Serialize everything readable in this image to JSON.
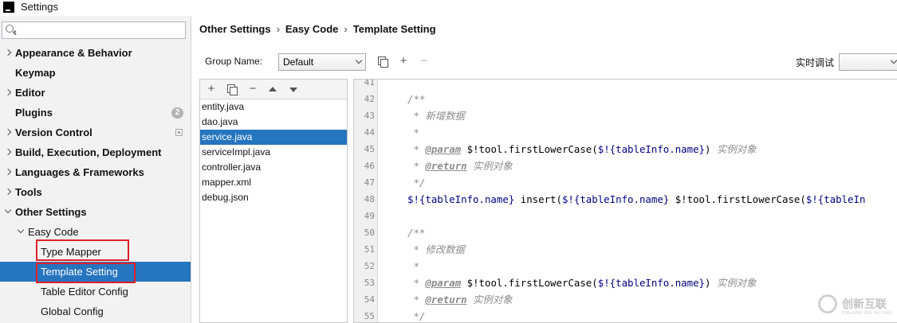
{
  "window": {
    "title": "Settings"
  },
  "search": {
    "value": "",
    "placeholder": ""
  },
  "sidebar": {
    "items": [
      {
        "label": "Appearance & Behavior"
      },
      {
        "label": "Keymap"
      },
      {
        "label": "Editor"
      },
      {
        "label": "Plugins",
        "badge": "2"
      },
      {
        "label": "Version Control"
      },
      {
        "label": "Build, Execution, Deployment"
      },
      {
        "label": "Languages & Frameworks"
      },
      {
        "label": "Tools"
      },
      {
        "label": "Other Settings"
      },
      {
        "label": "Easy Code"
      },
      {
        "label": "Type Mapper"
      },
      {
        "label": "Template Setting"
      },
      {
        "label": "Table Editor Config"
      },
      {
        "label": "Global Config"
      }
    ],
    "selected": "Template Setting"
  },
  "breadcrumb": {
    "items": [
      "Other Settings",
      "Easy Code",
      "Template Setting"
    ],
    "separator": "›"
  },
  "toolbar": {
    "group_label": "Group Name:",
    "group_value": "Default",
    "realtime_label": "实时调试",
    "realtime_value": ""
  },
  "files": {
    "items": [
      "entity.java",
      "dao.java",
      "service.java",
      "serviceImpl.java",
      "controller.java",
      "mapper.xml",
      "debug.json"
    ],
    "selected": "service.java"
  },
  "editor": {
    "line_numbers": [
      "41",
      "42",
      "43",
      "44",
      "45",
      "46",
      "47",
      "48",
      "49",
      "50",
      "51",
      "52",
      "53",
      "54",
      "55"
    ],
    "code": {
      "l42": "/**",
      "l43_star": " * ",
      "l43_text": "新增数据",
      "l44": " *",
      "l45_star": " * ",
      "l45_tag": "@param",
      "l45_a": " $!tool.firstLowerCase(",
      "l45_var": "$!{tableInfo.name}",
      "l45_b": ") ",
      "l45_text": "实例对象",
      "l46_star": " * ",
      "l46_tag": "@return",
      "l46_text": " 实例对象",
      "l47": " */",
      "l48_var1": "$!{tableInfo.name}",
      "l48_a": " insert(",
      "l48_var2": "$!{tableInfo.name}",
      "l48_b": " $!tool.firstLowerCase(",
      "l48_var3": "$!{tableIn",
      "l50": "/**",
      "l51_star": " * ",
      "l51_text": "修改数据",
      "l52": " *",
      "l53_star": " * ",
      "l53_tag": "@param",
      "l53_a": " $!tool.firstLowerCase(",
      "l53_var": "$!{tableInfo.name}",
      "l53_b": ") ",
      "l53_text": "实例对象",
      "l54_star": " * ",
      "l54_tag": "@return",
      "l54_text": " 实例对象",
      "l55": " */"
    }
  },
  "watermark": {
    "text": "创新互联",
    "sub": "CHUANG XIN HU LIAN"
  },
  "colors": {
    "selection": "#2675bf",
    "highlight_box": "#e0202a",
    "code_var": "#000080",
    "comment": "#8c8c8c"
  }
}
